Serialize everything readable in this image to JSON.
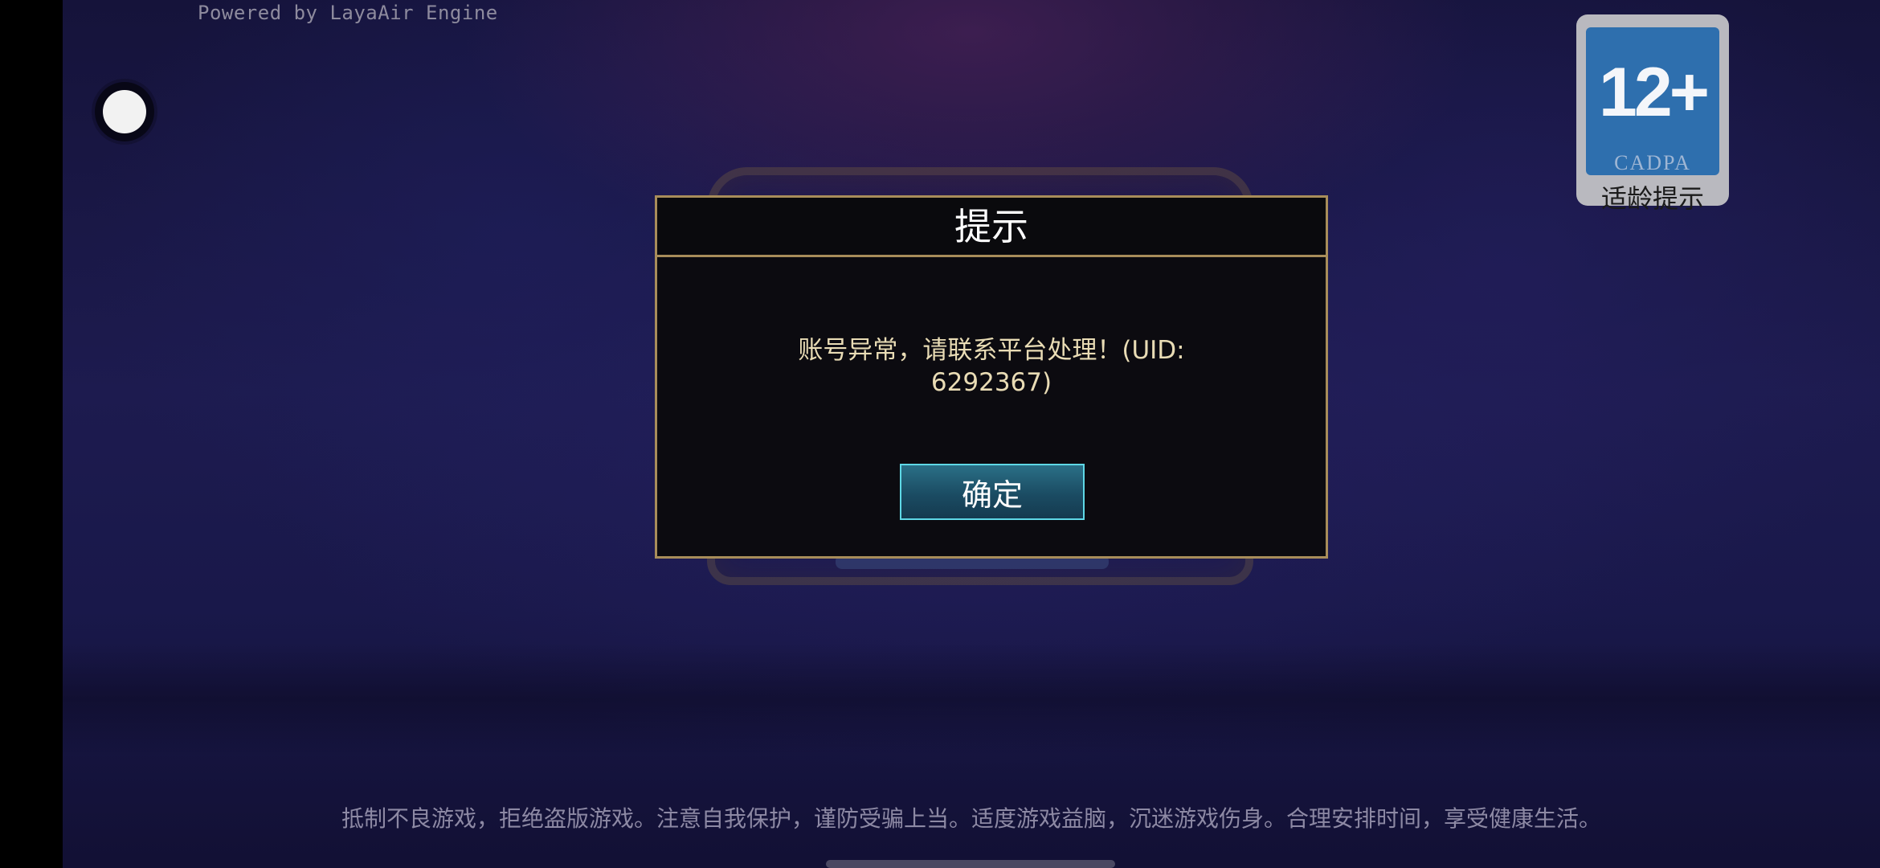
{
  "engine_credit": "Powered by LayaAir Engine",
  "age_rating": {
    "number": "12+",
    "org": "CADPA",
    "label": "适龄提示"
  },
  "dialog": {
    "title": "提示",
    "message_line1": "账号异常，请联系平台处理！(UID:",
    "message_line2": "6292367)",
    "confirm_label": "确定"
  },
  "health_notice": "抵制不良游戏，拒绝盗版游戏。注意自我保护，谨防受骗上当。适度游戏益脑，沉迷游戏伤身。合理安排时间，享受健康生活。",
  "colors": {
    "dialog_border": "#a88d5a",
    "message_text": "#e9dcb5",
    "button_border": "#5ed8e6",
    "badge_blue": "#2e6fae"
  }
}
